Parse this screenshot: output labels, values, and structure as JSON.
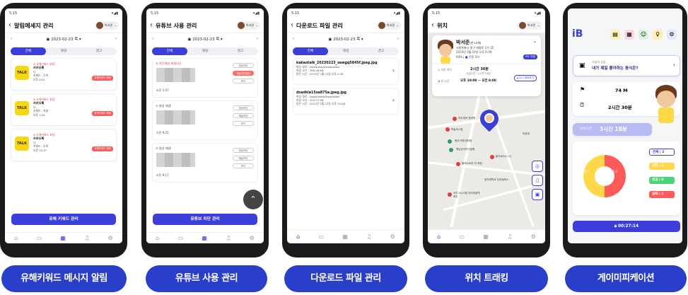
{
  "status": {
    "time": "5:15"
  },
  "phones": [
    {
      "title": "알림메세지 관리",
      "date": "2023-02-23 목",
      "user": "박서준",
      "tabs": [
        "전체",
        "재생",
        "경고"
      ],
      "cards": [
        {
          "warn": "유해키워드 포함",
          "app": "카카오톡",
          "from": "나",
          "keyword": "키워드 : 도박",
          "time": "오후 4:51",
          "btn": "유해키워드 해제"
        },
        {
          "warn": "유해키워드 포함",
          "app": "카카오톡",
          "from": "나",
          "keyword": "키워드 : 자살",
          "time": "오후 1:15",
          "btn": "유해키워드 해제"
        },
        {
          "warn": "유해키워드 포함",
          "app": "카카오톡",
          "from": "나",
          "keyword": "키워드 : 도박",
          "time": "오전 11:37",
          "btn": "유해키워드 해제"
        }
      ],
      "talk": "TALK",
      "main_btn": "유해 키워드 관리"
    },
    {
      "title": "유튜브 사용 관리",
      "date": "2023-02-23 목",
      "user": "박서준",
      "tabs": [
        "전체",
        "재생",
        "경고"
      ],
      "cards": [
        {
          "status": "차단채널 재생시도",
          "time": "오후 1:47",
          "btns": [
            "영상차단",
            "채널차단해제",
            "보기"
          ]
        },
        {
          "status": "영상 재생",
          "time": "오전 9:25",
          "btns": [
            "영상차단",
            "채널차단",
            "보기"
          ]
        },
        {
          "status": "영상 재생",
          "time": "오전 9:17",
          "btns": [
            "영상차단",
            "채널차단",
            "보기"
          ]
        }
      ],
      "main_btn": "유튜브 차단 관리"
    },
    {
      "title": "다운로드 파일 관리",
      "date": "2023-02-23 목",
      "user": "박서준",
      "tabs": [
        "전체",
        "재생",
        "경고"
      ],
      "files": [
        {
          "name": "kakaotalk_20230223_sawgq5845f.jpeg.jpg",
          "path": "파일 경로 : /www/www/www/www",
          "size": "파일 크기 : 366.28 KB",
          "time": "받은 시간 : 2023년 2월 23일 오후 4:30"
        },
        {
          "name": "dsadkla15sa875a.jpeg.jpg",
          "path": "파일 경로 : /www/www/www/www",
          "size": "파일 크기 : 102.07 KB",
          "time": "받은 시간 : 2023년 2월 23일 오후 10:48"
        }
      ]
    },
    {
      "title": "위치",
      "user": "박서준",
      "child_name": "박서준",
      "child_age": "(만 10세)",
      "address": "서울특별시 중구 태평로 1가 35",
      "updated": "2023년 3월 10일 오후 6:39",
      "battery": "60%",
      "mode": "진동 모드",
      "mode_btn": "모드 변경",
      "today_label": "하루 위치",
      "today_value": "2시간 30분",
      "today_sub": "(납은시간 : 2시간 16분)",
      "safe_label": "방 시간",
      "safe_value": "오후 10:00 ~ 오전 8:00",
      "lock_btn": "다시 계속하기",
      "places": [
        "아주캐어 한의원",
        "하늘의시립",
        "동대 보훈센터점",
        "해님논어린이공원",
        "흥가로24시 나",
        "팔레스트아 아 처럼",
        "양지대학교 인문캠퍼스",
        "국가고시시험 진미대생역하인",
        "미공대"
      ]
    },
    {
      "q_label": "오늘의 공감",
      "q_text": "내가 제일 좋아하는 음식은?",
      "steps": "74 M",
      "time_total": "2시간 30분",
      "remain_label": "남은시간",
      "remain": "3시간 18분",
      "stats": [
        {
          "label": "전체 | 2",
          "color": "#ffffff"
        },
        {
          "label": "진행 | 1",
          "color": "#ffd84a"
        },
        {
          "label": "성공 | 0",
          "color": "#4fd17a"
        },
        {
          "label": "실패 | 1",
          "color": "#ff5a5a"
        }
      ],
      "pie_values": [
        "50.0",
        "50.0"
      ],
      "timer": "00:27:14"
    }
  ],
  "pills": [
    "유해키워드 메시지 알림",
    "유튜브 사용 관리",
    "다운로드 파일 관리",
    "위치 트래킹",
    "게이미피케이션"
  ],
  "colors": {
    "primary": "#3b3ed9",
    "danger": "#ff5a5a",
    "pill": "#2a3fc9"
  }
}
